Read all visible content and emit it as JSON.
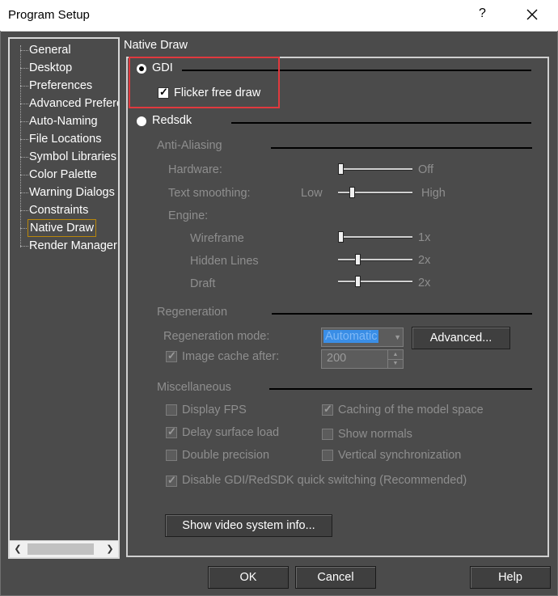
{
  "window": {
    "title": "Program Setup",
    "help_glyph": "?",
    "close_icon": "close-icon"
  },
  "tree": {
    "items": [
      "General",
      "Desktop",
      "Preferences",
      "Advanced Preferences",
      "Auto-Naming",
      "File Locations",
      "Symbol Libraries",
      "Color Palette",
      "Warning Dialogs",
      "Constraints",
      "Native Draw",
      "Render Manager"
    ],
    "selected": "Native Draw"
  },
  "panel": {
    "header": "Native Draw",
    "gdi_label": "GDI",
    "flicker_label": "Flicker free draw",
    "redsdk_label": "Redsdk",
    "anti_aliasing": {
      "header": "Anti-Aliasing",
      "hardware_label": "Hardware:",
      "hardware_value": "Off",
      "text_smoothing_label": "Text smoothing:",
      "low": "Low",
      "high": "High",
      "engine_label": "Engine:",
      "wireframe_label": "Wireframe",
      "wireframe_value": "1x",
      "hidden_lines_label": "Hidden Lines",
      "hidden_lines_value": "2x",
      "draft_label": "Draft",
      "draft_value": "2x"
    },
    "regeneration": {
      "header": "Regeneration",
      "mode_label": "Regeneration mode:",
      "mode_value": "Automatic",
      "advanced_button": "Advanced...",
      "cache_label": "Image cache after:",
      "cache_value": "200"
    },
    "misc": {
      "header": "Miscellaneous",
      "display_fps": "Display FPS",
      "delay_surface_load": "Delay surface load",
      "double_precision": "Double precision",
      "caching_model_space": "Caching of the model space",
      "show_normals": "Show normals",
      "vertical_sync": "Vertical synchronization",
      "disable_switching": "Disable GDI/RedSDK quick switching (Recommended)"
    },
    "video_button": "Show video system info..."
  },
  "footer": {
    "ok": "OK",
    "cancel": "Cancel",
    "help": "Help"
  },
  "colors": {
    "background": "#4b4b4b",
    "highlight": "#e0393e",
    "selection": "#3a8ee6"
  }
}
